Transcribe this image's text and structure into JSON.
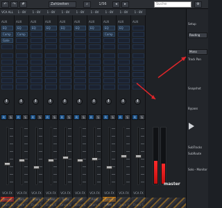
{
  "toolbar": {
    "zahlzeiten": "Zahlzeiten",
    "page": "1/56",
    "search_placeholder": "Suche",
    "icons": [
      "undo-icon",
      "redo-icon",
      "hash-icon"
    ]
  },
  "strips": [
    {
      "head": "VCA ALL",
      "aux": "AUX",
      "slots": [
        "EQ",
        "Comp",
        "Gate"
      ],
      "footer1": "VCA FX",
      "name": "Drums",
      "footer2": "Drum S",
      "fader": 0.36,
      "name_color": "#d11d1d"
    },
    {
      "head": "1 - 8V",
      "aux": "AUX",
      "slots": [
        "EQ",
        "Comp"
      ],
      "footer1": "VCA FX",
      "name": "Kick",
      "footer2": "Drum S",
      "fader": 0.42,
      "name_color": "#2f3338"
    },
    {
      "head": "1 - 8V",
      "aux": "AUX",
      "slots": [
        "EQ"
      ],
      "footer1": "VCA FX",
      "name": "Snare",
      "footer2": "Drum S",
      "fader": 0.3,
      "name_color": "#2f3338"
    },
    {
      "head": "1 - 8V",
      "aux": "AUX",
      "slots": [
        "EQ"
      ],
      "footer1": "VCA FX",
      "name": "Hi-Hat",
      "footer2": "Drum S",
      "fader": 0.42,
      "name_color": "#2f3338"
    },
    {
      "head": "1 - 8V",
      "aux": "AUX",
      "slots": [
        "EQ"
      ],
      "footer1": "VCA FX",
      "name": "Toms",
      "footer2": "Drum S",
      "fader": 0.48,
      "name_color": "#2f3338"
    },
    {
      "head": "1 - 8V",
      "aux": "AUX",
      "slots": [
        "EQ"
      ],
      "footer1": "VCA FX",
      "name": "OH",
      "footer2": "Drum S",
      "fader": 0.42,
      "name_color": "#2f3338"
    },
    {
      "head": "1 - 8V",
      "aux": "AUX",
      "slots": [
        "EQ"
      ],
      "footer1": "VCA FX",
      "name": "Amb",
      "footer2": "Drum S",
      "fader": 0.45,
      "name_color": "#2f3338"
    },
    {
      "head": "1 - 8V",
      "aux": "AUX",
      "slots": [
        "EQ",
        "Comp"
      ],
      "footer1": "VCA FX",
      "name": "Drum Bus",
      "footer2": "Drum S",
      "fader": 0.3,
      "name_color": "#c57a15"
    },
    {
      "head": "1 - 8V",
      "aux": "AUX",
      "slots": [
        "EQ"
      ],
      "footer1": "VCA FX",
      "name": "",
      "footer2": "Drum S",
      "fader": 0.5,
      "name_color": "#2f3338"
    },
    {
      "head": "1 - 8V",
      "aux": "AUX",
      "slots": [],
      "footer1": "VCA FX",
      "name": "",
      "footer2": "Drum S",
      "fader": 0.5,
      "name_color": "#2f3338"
    }
  ],
  "meters": [
    0.4,
    0.35
  ],
  "right_panel": {
    "title": "Setup",
    "items": [
      "Routing",
      "Mono",
      "Track Pan"
    ],
    "section": "Snapshot",
    "labels": [
      "Bypass",
      "SubTracks",
      "SubRoute"
    ],
    "footer": "Solo - Monitor"
  },
  "master_label": "master",
  "colors": {
    "accent": "#1b4f83",
    "arrow": "#e0262a"
  }
}
